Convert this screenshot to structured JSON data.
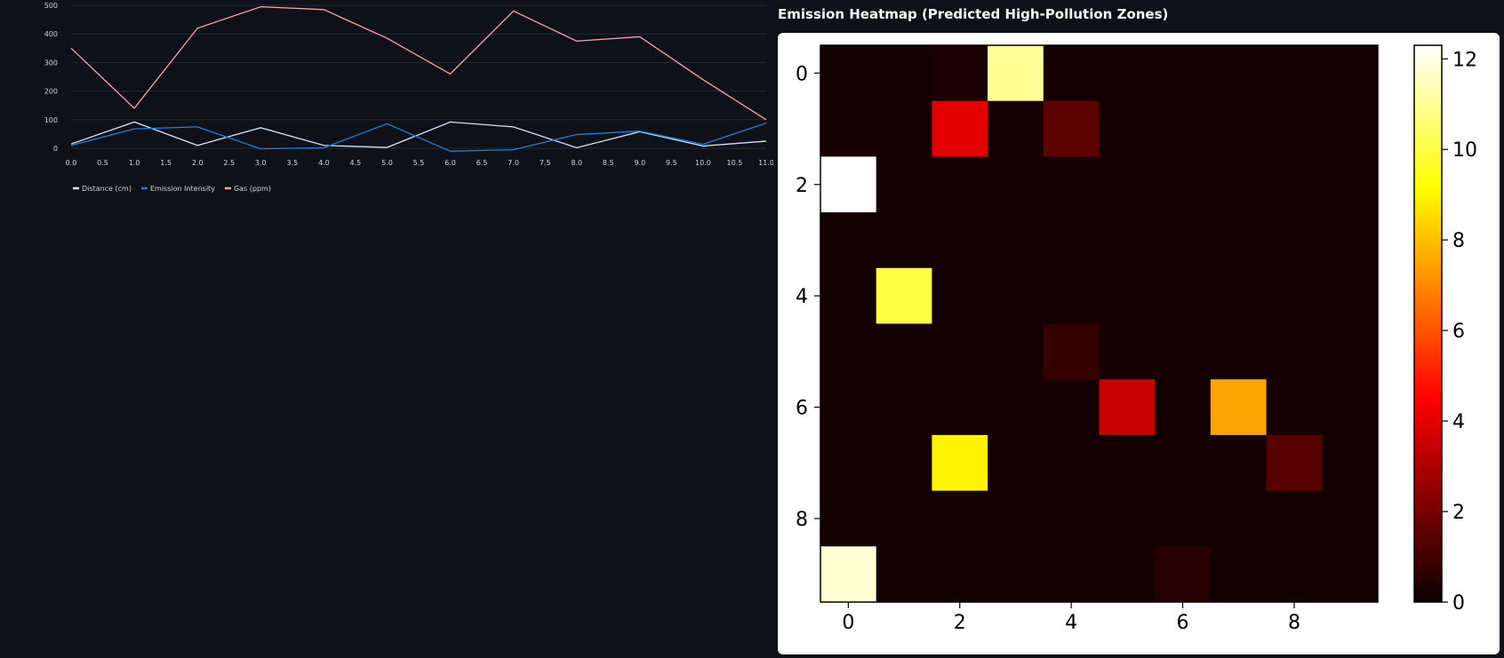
{
  "heatmap_title": "Emission Heatmap (Predicted High-Pollution Zones)",
  "chart_data": [
    {
      "type": "line",
      "x": [
        0,
        1,
        2,
        3,
        4,
        5,
        6,
        7,
        8,
        9,
        10,
        11
      ],
      "x_ticks": [
        0,
        0.5,
        1,
        1.5,
        2,
        2.5,
        3,
        3.5,
        4,
        4.5,
        5,
        5.5,
        6,
        6.5,
        7,
        7.5,
        8,
        8.5,
        9,
        9.5,
        10,
        10.5,
        11
      ],
      "y_ticks": [
        0,
        100,
        200,
        300,
        400,
        500
      ],
      "ylim": [
        0,
        500
      ],
      "xlim": [
        0,
        11
      ],
      "grid": true,
      "legend_position": "bottom-left",
      "series": [
        {
          "name": "Distance (cm)",
          "color": "#cfe3ff",
          "values": [
            15,
            92,
            10,
            72,
            10,
            3,
            92,
            75,
            2,
            58,
            8,
            25
          ]
        },
        {
          "name": "Emission Intensity",
          "color": "#1f7fe0",
          "values": [
            10,
            68,
            75,
            -2,
            2,
            86,
            -10,
            -5,
            48,
            60,
            14,
            88
          ]
        },
        {
          "name": "Gas (ppm)",
          "color": "#ffa3a3",
          "values": [
            350,
            140,
            420,
            495,
            485,
            385,
            260,
            480,
            375,
            390,
            240,
            100
          ]
        }
      ]
    },
    {
      "type": "heatmap",
      "title": "",
      "colormap": "hot",
      "vmin": 0,
      "vmax": 12.3,
      "x_ticks": [
        0,
        2,
        4,
        6,
        8
      ],
      "y_ticks": [
        0,
        2,
        4,
        6,
        8
      ],
      "colorbar_ticks": [
        0,
        2,
        4,
        6,
        8,
        10,
        12
      ],
      "matrix": [
        [
          0.2,
          0.2,
          0.3,
          11.0,
          0.2,
          0.2,
          0.2,
          0.2,
          0.2,
          0.2
        ],
        [
          0.2,
          0.2,
          4.0,
          0.2,
          1.5,
          0.2,
          0.2,
          0.2,
          0.2,
          0.2
        ],
        [
          12.3,
          0.2,
          0.2,
          0.2,
          0.2,
          0.2,
          0.2,
          0.2,
          0.2,
          0.2
        ],
        [
          0.2,
          0.2,
          0.2,
          0.2,
          0.2,
          0.2,
          0.2,
          0.2,
          0.2,
          0.2
        ],
        [
          0.2,
          10.0,
          0.2,
          0.2,
          0.2,
          0.2,
          0.2,
          0.2,
          0.2,
          0.2
        ],
        [
          0.2,
          0.2,
          0.2,
          0.2,
          0.8,
          0.2,
          0.2,
          0.2,
          0.2,
          0.2
        ],
        [
          0.2,
          0.2,
          0.2,
          0.2,
          0.2,
          3.5,
          0.2,
          7.5,
          0.2,
          0.2
        ],
        [
          0.2,
          0.2,
          9.0,
          0.2,
          0.2,
          0.2,
          0.2,
          0.2,
          1.4,
          0.2
        ],
        [
          0.2,
          0.2,
          0.2,
          0.2,
          0.2,
          0.2,
          0.2,
          0.2,
          0.2,
          0.2
        ],
        [
          11.8,
          0.2,
          0.2,
          0.2,
          0.2,
          0.2,
          0.5,
          0.2,
          0.2,
          0.2
        ]
      ]
    }
  ]
}
